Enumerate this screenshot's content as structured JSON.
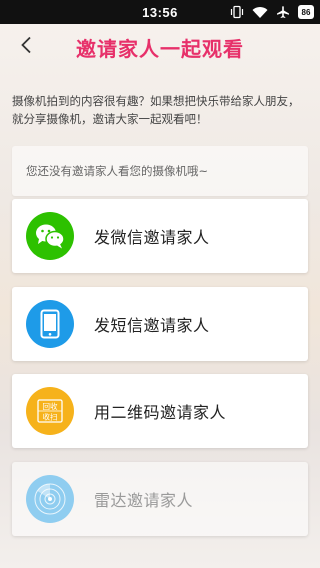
{
  "status_bar": {
    "time": "13:56",
    "battery": "86"
  },
  "header": {
    "title": "邀请家人一起观看"
  },
  "intro": {
    "text": "摄像机拍到的内容很有趣？如果想把快乐带给家人朋友，就分享摄像机，邀请大家一起观看吧！"
  },
  "notice": {
    "text": "您还没有邀请家人看您的摄像机哦~"
  },
  "options": [
    {
      "label": "发微信邀请家人",
      "icon": "wechat-icon",
      "color": "#2dc100"
    },
    {
      "label": "发短信邀请家人",
      "icon": "phone-sms-icon",
      "color": "#1e9be8"
    },
    {
      "label": "用二维码邀请家人",
      "icon": "qrcode-icon",
      "color": "#f6b21b"
    },
    {
      "label": "雷达邀请家人",
      "icon": "radar-icon",
      "color": "#8fcdf0",
      "disabled": true
    }
  ],
  "qr_icon_text": [
    "回收",
    "收扫"
  ]
}
